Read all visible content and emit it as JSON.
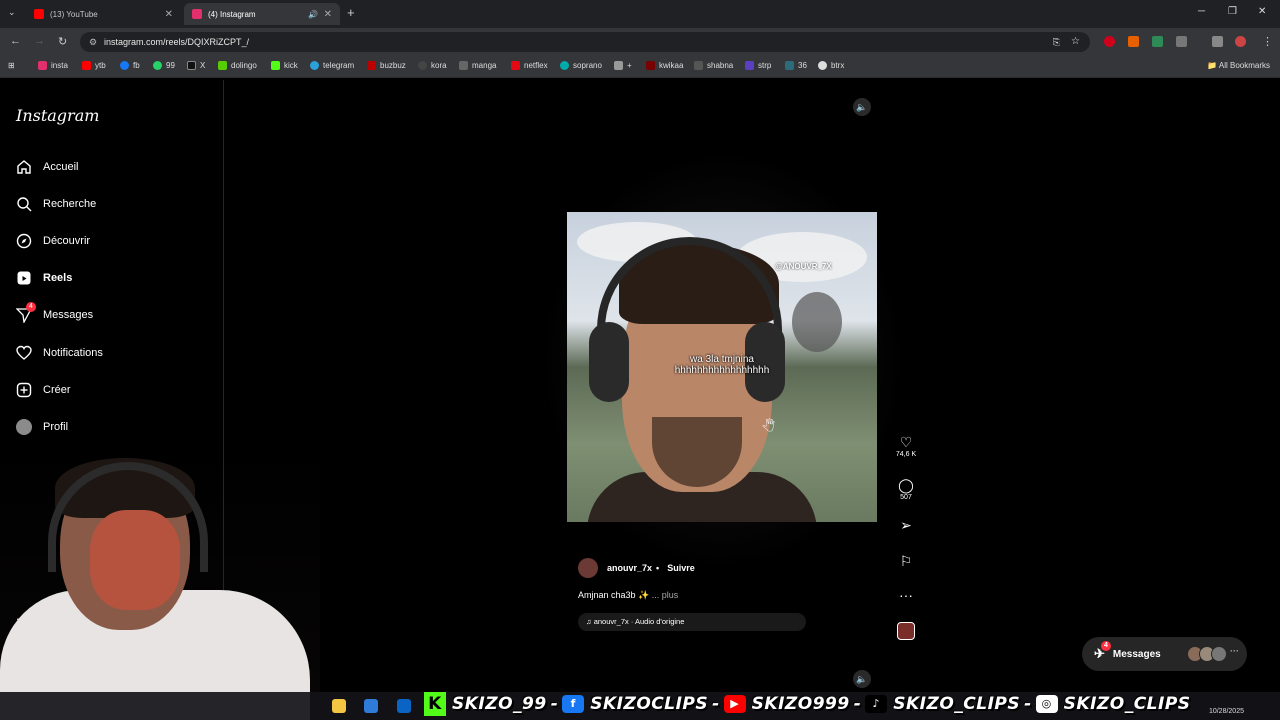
{
  "browser": {
    "tabs": [
      {
        "title": "(13) YouTube",
        "active": false
      },
      {
        "title": "(4) Instagram",
        "active": true
      }
    ],
    "url": "instagram.com/reels/DQIXRiZCPT_/",
    "bookmarks": [
      "insta",
      "ytb",
      "fb",
      "99",
      "X",
      "dolingo",
      "kick",
      "telegram",
      "buzbuz",
      "kora",
      "manga",
      "netflex",
      "soprano",
      "+",
      "kwikaa",
      "shabna",
      "strp",
      "36",
      "btrx"
    ],
    "all_bookmarks": "All Bookmarks"
  },
  "sidebar": {
    "logo": "Instagram",
    "items": [
      {
        "label": "Accueil",
        "icon": "home-icon"
      },
      {
        "label": "Recherche",
        "icon": "search-icon"
      },
      {
        "label": "Découvrir",
        "icon": "compass-icon"
      },
      {
        "label": "Reels",
        "icon": "reels-icon"
      },
      {
        "label": "Messages",
        "icon": "messenger-icon",
        "badge": "4"
      },
      {
        "label": "Notifications",
        "icon": "heart-icon"
      },
      {
        "label": "Créer",
        "icon": "plus-icon"
      },
      {
        "label": "Profil",
        "icon": "avatar"
      }
    ]
  },
  "reel": {
    "video_caption_line1": "wa 3la tmjnina",
    "video_caption_line2": "hhhhhhhhhhhhhhhhh",
    "video_watermark": "@ANOUVR_7X",
    "author": "anouvr_7x",
    "separator": "•",
    "follow_label": "Suivre",
    "caption": "Amjnan cha3b ✨",
    "more_label": "... plus",
    "audio": "anouvr_7x · Audio d'origine",
    "likes": "74,6 K",
    "comments": "507"
  },
  "messages_pill": {
    "label": "Messages",
    "badge": "4"
  },
  "overlay": {
    "kick": "SKIZO_99",
    "facebook": "SKIZOCLIPS",
    "youtube": "SKIZO999",
    "tiktok": "SKIZO_CLIPS",
    "instagram": "SKIZO_CLIPS",
    "separator": "-"
  },
  "taskbar": {
    "date": "10/28/2025"
  },
  "colors": {
    "badge": "#ff3040",
    "kick": "#53fc18",
    "youtube": "#ff0000",
    "instagram": "#e1306c"
  }
}
